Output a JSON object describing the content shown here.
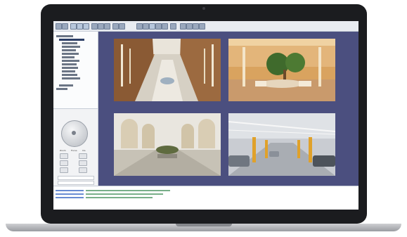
{
  "app": {
    "window_title": ""
  },
  "panels": {
    "tree_label": "",
    "ptz_title": "",
    "ptz_title_right": "",
    "ptz_labels": [
      "Zoom",
      "Focus",
      "Iris"
    ]
  },
  "video_tiles": [
    {
      "id": "tile-1",
      "caption": "",
      "scene": "atrium-walkway"
    },
    {
      "id": "tile-2",
      "caption": "",
      "scene": "lobby-palms"
    },
    {
      "id": "tile-3",
      "caption": "",
      "scene": "corridor-arches"
    },
    {
      "id": "tile-4",
      "caption": "",
      "scene": "parking-garage"
    }
  ],
  "log": {
    "lines": [
      {
        "time": "",
        "message": ""
      },
      {
        "time": "",
        "message": ""
      },
      {
        "time": "",
        "message": ""
      }
    ]
  },
  "colors": {
    "grid_background": "#4b4f7f",
    "laptop_bezel": "#1b1c1f",
    "log_link": "#2a5bbf",
    "log_ok": "#1f7a3a"
  }
}
